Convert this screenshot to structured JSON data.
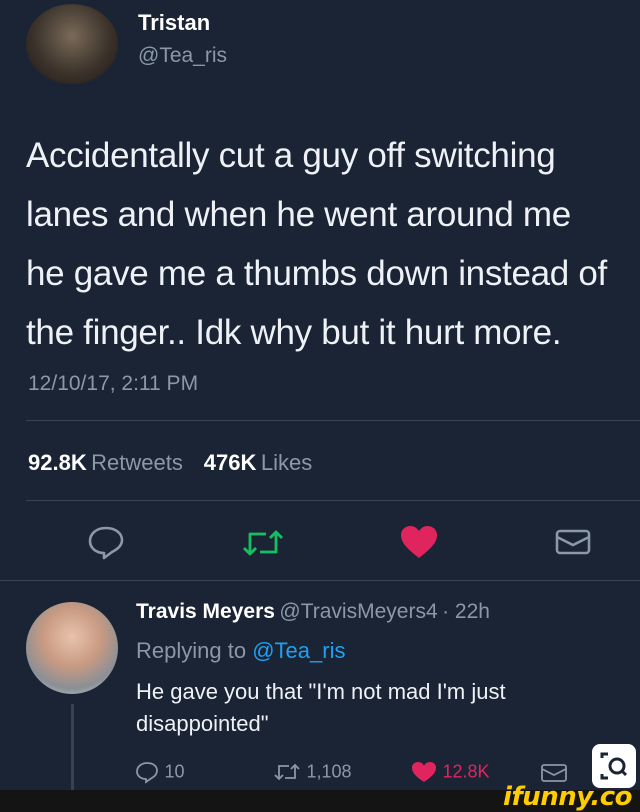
{
  "tweet": {
    "author_name": "Tristan",
    "author_handle": "@Tea_ris",
    "text_lines": [
      "Accidentally cut a guy off switching",
      "lanes and when he went around me",
      "he gave me a thumbs down instead of",
      "the finger.. Idk why but it hurt more."
    ],
    "timestamp": "12/10/17, 2:11 PM",
    "retweets_count": "92.8K",
    "retweets_label": "Retweets",
    "likes_count": "476K",
    "likes_label": "Likes"
  },
  "actions": {
    "reply_icon": "speech-bubble-icon",
    "retweet_icon": "retweet-icon",
    "like_icon": "heart-icon",
    "dm_icon": "envelope-icon",
    "retweet_color": "#17bf63",
    "like_color": "#e0245e"
  },
  "reply": {
    "author_name": "Travis Meyers",
    "author_handle": "@TravisMeyers4",
    "time": "· 22h",
    "replying_prefix": "Replying to",
    "replying_handle": "@Tea_ris",
    "text_line1": "He gave you that \"I'm not mad I'm just",
    "text_line2": "disappointed\"",
    "reply_count": "10",
    "retweet_count": "1,108",
    "like_count": "12.8K"
  },
  "watermark": {
    "brand": "ifunny.co"
  },
  "colors": {
    "background": "#1b2434",
    "accent_blue": "#1da1f2",
    "watermark_yellow": "#ffcc00"
  }
}
